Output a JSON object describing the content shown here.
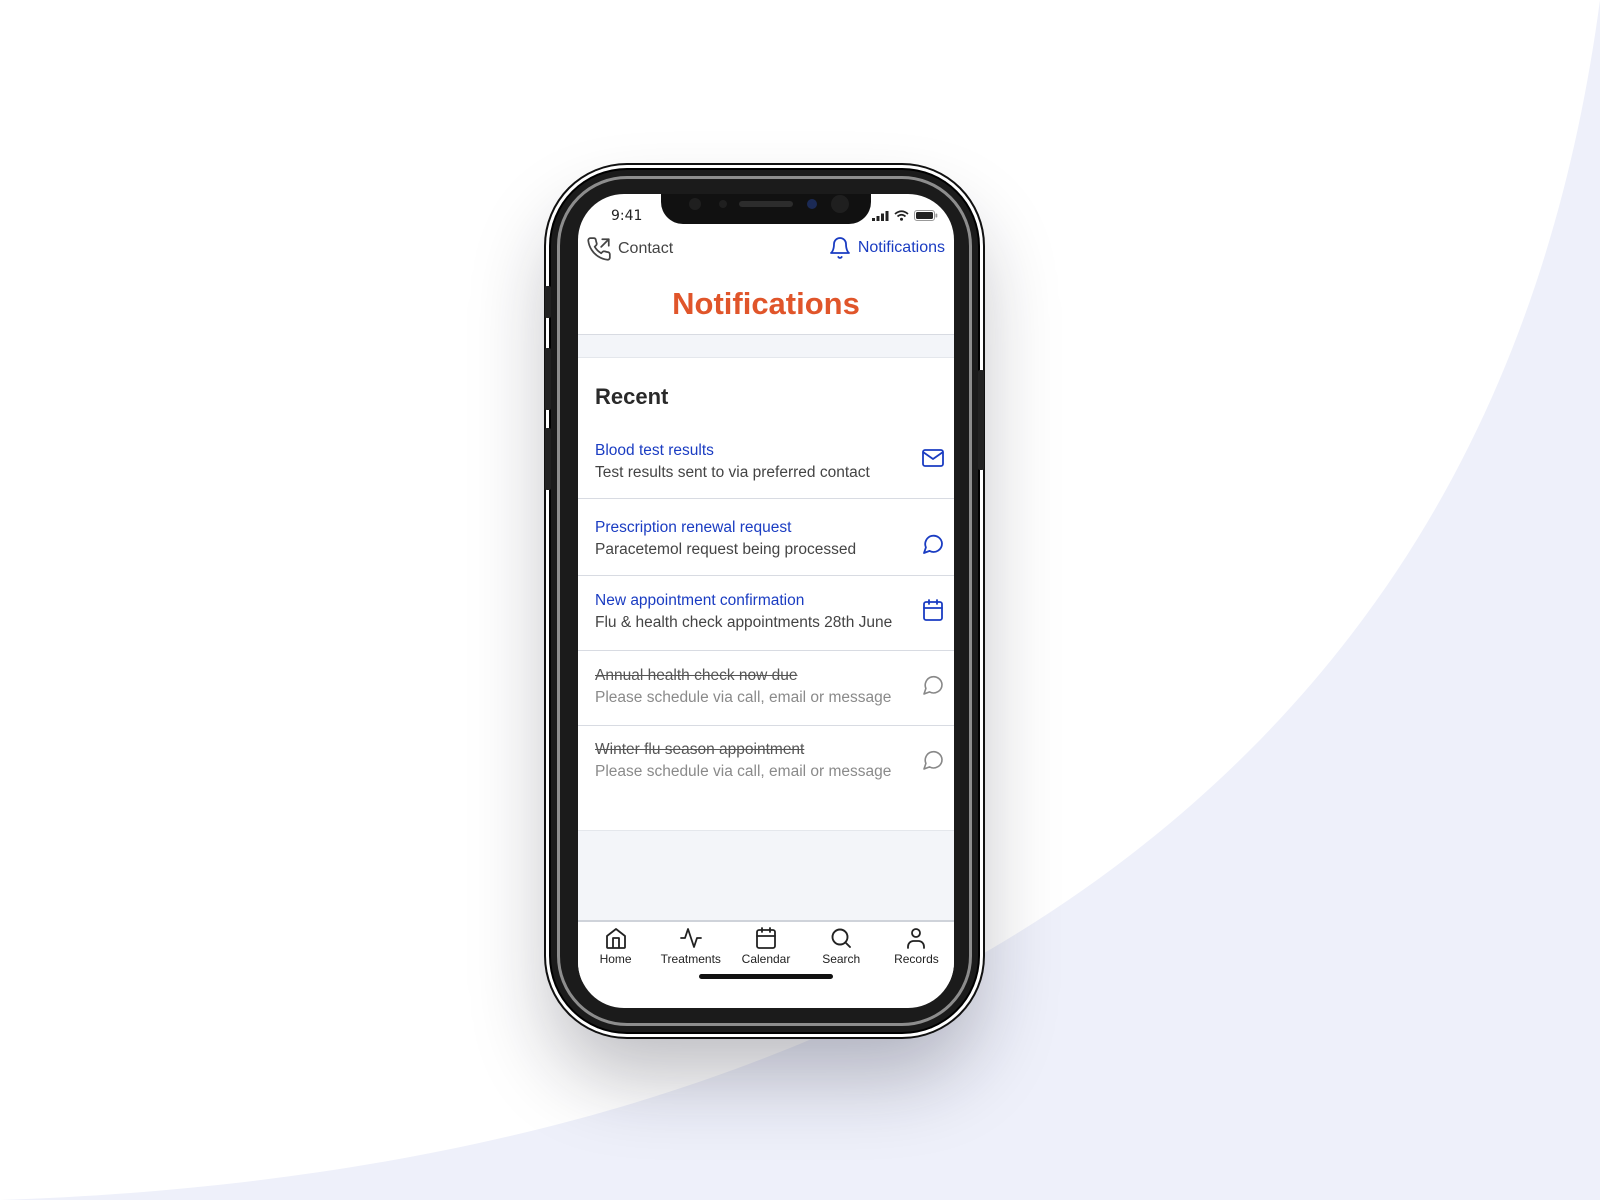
{
  "status_bar": {
    "time": "9:41"
  },
  "header": {
    "contact_label": "Contact",
    "notifications_label": "Notifications",
    "page_title": "Notifications"
  },
  "section": {
    "title": "Recent"
  },
  "notifications": [
    {
      "title": "Blood test results",
      "subtitle": "Test results sent to via preferred contact",
      "icon": "mail-icon",
      "read": false
    },
    {
      "title": "Prescription renewal request",
      "subtitle": "Paracetemol request being processed",
      "icon": "message-icon",
      "read": false
    },
    {
      "title": "New appointment confirmation",
      "subtitle": "Flu & health check appointments 28th June",
      "icon": "calendar-icon",
      "read": false
    },
    {
      "title": "Annual health check now due",
      "subtitle": "Please schedule via call, email or message",
      "icon": "message-icon",
      "read": true
    },
    {
      "title": "Winter flu season appointment",
      "subtitle": "Please schedule via call, email or message",
      "icon": "message-icon",
      "read": true
    }
  ],
  "tabbar": {
    "items": [
      {
        "label": "Home",
        "icon": "home-icon"
      },
      {
        "label": "Treatments",
        "icon": "pulse-icon"
      },
      {
        "label": "Calendar",
        "icon": "calendar-icon"
      },
      {
        "label": "Search",
        "icon": "search-icon"
      },
      {
        "label": "Records",
        "icon": "person-icon"
      }
    ]
  },
  "colors": {
    "accent_blue": "#1a3cc2",
    "title_orange": "#e0552a",
    "background_curve": "#eef0fa"
  }
}
